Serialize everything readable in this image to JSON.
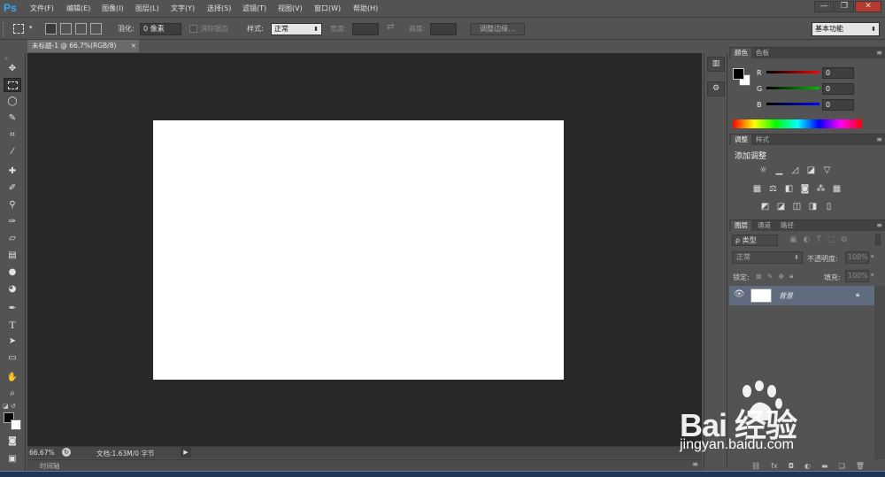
{
  "app": {
    "logo": "Ps"
  },
  "menu": [
    "文件(F)",
    "编辑(E)",
    "图像(I)",
    "图层(L)",
    "文字(Y)",
    "选择(S)",
    "滤镜(T)",
    "视图(V)",
    "窗口(W)",
    "帮助(H)"
  ],
  "window_controls": {
    "minimize": "—",
    "restore": "❐",
    "close": "✕"
  },
  "options": {
    "feather_label": "羽化:",
    "feather_value": "0 像素",
    "antialias_label": "消除锯齿",
    "style_label": "样式:",
    "style_value": "正常",
    "width_label": "宽度:",
    "height_label": "高度:",
    "refine_edge": "调整边缘...",
    "workspace": "基本功能"
  },
  "document": {
    "tab_title": "未标题-1 @ 66.7%(RGB/8)",
    "close": "×"
  },
  "status": {
    "zoom": "66.67%",
    "doc_info": "文档:1.63M/0 字节",
    "timeline_label": "时间轴"
  },
  "panels": {
    "color": {
      "tabs": [
        "颜色",
        "色板"
      ],
      "channels": [
        {
          "label": "R",
          "value": "0"
        },
        {
          "label": "G",
          "value": "0"
        },
        {
          "label": "B",
          "value": "0"
        }
      ]
    },
    "adjustments": {
      "tabs": [
        "调整",
        "样式"
      ],
      "heading": "添加调整"
    },
    "layers": {
      "tabs": [
        "图层",
        "通道",
        "路径"
      ],
      "filter_label": "ρ 类型",
      "blend_mode": "正常",
      "opacity_label": "不透明度:",
      "opacity_value": "100%",
      "lock_label": "锁定:",
      "fill_label": "填充:",
      "fill_value": "100%",
      "layer_name": "背景"
    }
  },
  "watermark": {
    "logo_text": "Bai  经验",
    "url": "jingyan.baidu.com"
  },
  "colors": {
    "ui_gray": "#535353",
    "workspace": "#282828",
    "canvas": "#ffffff",
    "ps_blue": "#31a8ff",
    "selected_layer": "#5f6c80"
  }
}
